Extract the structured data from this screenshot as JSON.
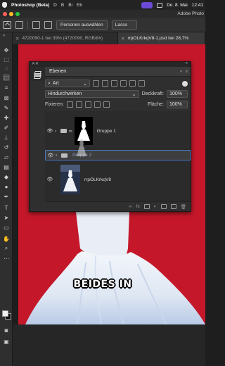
{
  "menubar": {
    "app_name": "Photoshop (Beta)",
    "menus": [
      "D",
      "B",
      "Bi",
      "Eb"
    ],
    "datetime": "Do. 8. Mai",
    "time": "12:41"
  },
  "apptitle": {
    "name": "Adobe Photo"
  },
  "optionsbar": {
    "select_subject_label": "Personen auswählen",
    "lasso_label": "Lasso"
  },
  "tabs": [
    {
      "label": "4720090-1 bei 39% (4720090, RGB/8#)"
    },
    {
      "label": "rrpOLKrkqV8-1.psd bei 28,7%"
    }
  ],
  "layers_panel": {
    "title": "Ebenen",
    "filter_kind": "Art",
    "blend_mode": "Hindurchwirken",
    "opacity_label": "Deckkraft:",
    "opacity_value": "100%",
    "lock_label": "Fixieren:",
    "fill_label": "Fläche:",
    "fill_value": "100%",
    "layers": [
      {
        "name": "Gruppe 1",
        "type": "group-with-mask",
        "visible": true,
        "selected": false
      },
      {
        "name": "Gruppe 2",
        "type": "group",
        "visible": true,
        "selected": true
      },
      {
        "name": "rrpOLKrkqV8",
        "type": "pixel",
        "visible": true,
        "selected": false
      }
    ],
    "footer_fx": "fx"
  },
  "caption": "BEIDES IN",
  "colors": {
    "canvas_bg": "#c4182a",
    "selection": "#4a78c2",
    "panel_bg": "#2f2f2f"
  }
}
